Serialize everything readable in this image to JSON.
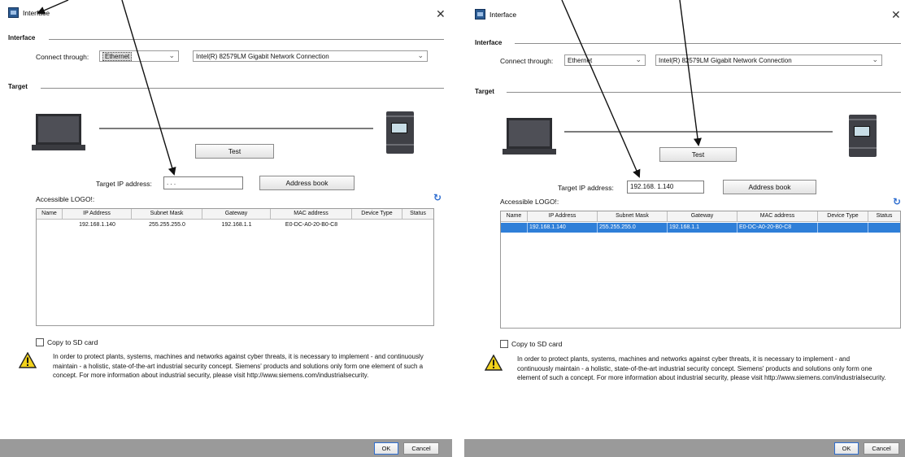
{
  "left": {
    "title": "Interface",
    "interface_section": "Interface",
    "connect_label": "Connect through:",
    "connect_value": "Ethernet",
    "adapter_value": "Intel(R) 82579LM Gigabit Network Connection",
    "target_section": "Target",
    "test_button": "Test",
    "target_ip_label": "Target IP address:",
    "target_ip_value": ". . .",
    "address_book_button": "Address book",
    "accessible_label": "Accessible LOGO!:",
    "columns": [
      "Name",
      "IP Address",
      "Subnet Mask",
      "Gateway",
      "MAC address",
      "Device Type",
      "Status"
    ],
    "row": [
      "",
      "192.168.1.140",
      "255.255.255.0",
      "192.168.1.1",
      "E0-DC-A0-20-B0-C8",
      "",
      ""
    ],
    "copy_sd": "Copy to SD card",
    "warning": "In order to protect plants, systems, machines and networks against cyber threats, it is necessary to implement - and continuously maintain - a holistic, state-of-the-art industrial security concept. Siemens' products and solutions only form one element of such a concept. For more information about industrial security, please visit http://www.siemens.com/industrialsecurity.",
    "ok_button": "OK",
    "cancel_button": "Cancel"
  },
  "right": {
    "title": "Interface",
    "interface_section": "Interface",
    "connect_label": "Connect through:",
    "connect_value": "Ethernet",
    "adapter_value": "Intel(R) 82579LM Gigabit Network Connection",
    "target_section": "Target",
    "test_button": "Test",
    "target_ip_label": "Target IP address:",
    "target_ip_value": "192.168. 1.140",
    "address_book_button": "Address book",
    "accessible_label": "Accessible LOGO!:",
    "columns": [
      "Name",
      "IP Address",
      "Subnet Mask",
      "Gateway",
      "MAC address",
      "Device Type",
      "Status"
    ],
    "row": [
      "",
      "192.168.1.140",
      "255.255.255.0",
      "192.168.1.1",
      "E0-DC-A0-20-B0-C8",
      "",
      ""
    ],
    "copy_sd": "Copy to SD card",
    "warning": "In order to protect plants, systems, machines and networks against cyber threats, it is necessary to implement - and continuously maintain - a holistic, state-of-the-art industrial security concept. Siemens' products and solutions only form one element of such a concept. For more information about industrial security, please visit http://www.siemens.com/industrialsecurity.",
    "ok_button": "OK",
    "cancel_button": "Cancel"
  },
  "icons": {
    "close": "close-icon",
    "dropdown": "chevron-down-icon",
    "refresh": "refresh-icon",
    "warning": "warning-icon",
    "pc": "laptop-icon",
    "plc": "logo-device-icon"
  },
  "colors": {
    "selection": "#2f7fd8",
    "footer": "#9a9a9a",
    "refresh": "#2f6ed0",
    "warning_yellow": "#f2d21b"
  }
}
